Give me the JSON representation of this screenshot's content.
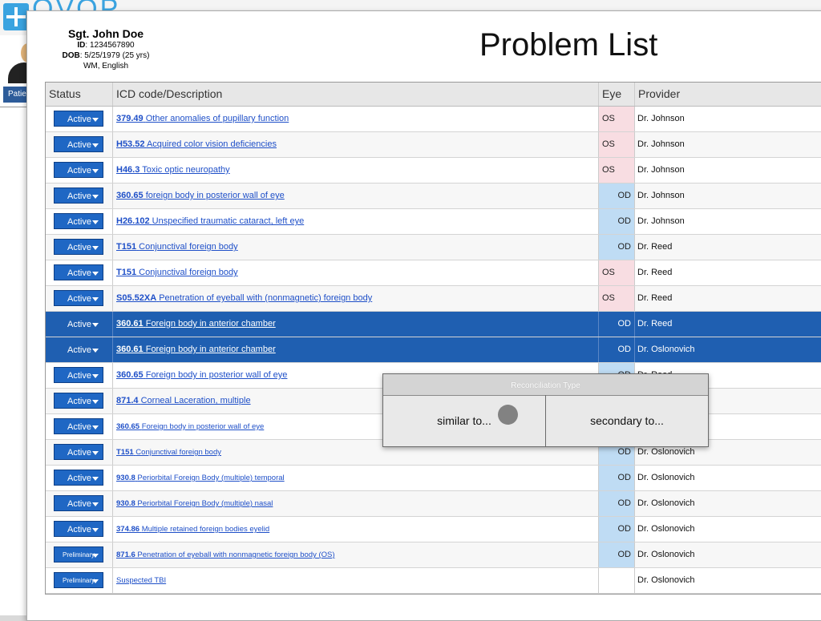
{
  "background": {
    "logo_text": "OVOP",
    "patient_tab": "Patie"
  },
  "patient": {
    "name": "Sgt. John Doe",
    "id_label": "ID",
    "id_value": ": 1234567890",
    "dob_label": "DOB",
    "dob_value": ": 5/25/1979 (25 yrs)",
    "demographics": "WM, English"
  },
  "page_title": "Problem List",
  "table": {
    "headers": {
      "status": "Status",
      "icd": "ICD code/Description",
      "eye": "Eye",
      "provider": "Provider"
    },
    "rows": [
      {
        "status": "Active",
        "code": "379.49",
        "desc": "Other anomalies of pupillary function",
        "eye": "OS",
        "provider": "Dr. Johnson"
      },
      {
        "status": "Active",
        "code": "H53.52",
        "desc": "Acquired color vision deficiencies",
        "eye": "OS",
        "provider": "Dr. Johnson"
      },
      {
        "status": "Active",
        "code": "H46.3",
        "desc": "Toxic optic neuropathy",
        "eye": "OS",
        "provider": "Dr. Johnson"
      },
      {
        "status": "Active",
        "code": "360.65",
        "desc": "foreign body in posterior wall of eye",
        "eye": "OD",
        "provider": "Dr. Johnson"
      },
      {
        "status": "Active",
        "code": "H26.102",
        "desc": "Unspecified traumatic cataract, left eye",
        "eye": "OD",
        "provider": "Dr. Johnson"
      },
      {
        "status": "Active",
        "code": "T151",
        "desc": "Conjunctival foreign body",
        "eye": "OD",
        "provider": "Dr. Reed"
      },
      {
        "status": "Active",
        "code": "T151",
        "desc": "Conjunctival foreign body",
        "eye": "OS",
        "provider": "Dr. Reed"
      },
      {
        "status": "Active",
        "code": "S05.52XA",
        "desc": "Penetration of eyeball with (nonmagnetic) foreign body",
        "eye": "OS",
        "provider": "Dr. Reed"
      },
      {
        "status": "Active",
        "code": "360.61",
        "desc": "Foreign body in anterior chamber",
        "eye": "OD",
        "provider": "Dr. Reed",
        "selected": true
      },
      {
        "status": "Active",
        "code": "360.61",
        "desc": "Foreign body in anterior chamber",
        "eye": "OD",
        "provider": "Dr. Oslonovich",
        "selected": true
      },
      {
        "status": "Active",
        "code": "360.65",
        "desc": "Foreign body in posterior wall of eye",
        "eye": "OD",
        "provider": "Dr. Reed"
      },
      {
        "status": "Active",
        "code": "871.4",
        "desc": "Corneal Laceration, multiple",
        "eye": "",
        "provider": ""
      },
      {
        "status": "Active",
        "code": "360.65",
        "desc": "Foreign body in posterior wall of eye",
        "eye": "",
        "provider": "",
        "small": true
      },
      {
        "status": "Active",
        "code": "T151",
        "desc": "Conjunctival foreign body",
        "eye": "OD",
        "provider": "Dr. Oslonovich",
        "small": true
      },
      {
        "status": "Active",
        "code": "930.8",
        "desc": "Periorbital Foreign Body (multiple) temporal",
        "eye": "OD",
        "provider": "Dr. Oslonovich",
        "small": true
      },
      {
        "status": "Active",
        "code": "930.8",
        "desc": "Periorbital Foreign Body (multiple) nasal",
        "eye": "OD",
        "provider": "Dr. Oslonovich",
        "small": true
      },
      {
        "status": "Active",
        "code": "374.86",
        "desc": "Multiple retained foreign bodies eyelid",
        "eye": "OD",
        "provider": "Dr. Oslonovich",
        "small": true
      },
      {
        "status": "Preliminary",
        "code": "871.6",
        "desc": "Penetration of eyeball with nonmagnetic foreign body (OS)",
        "eye": "OD",
        "provider": "Dr. Oslonovich",
        "small": true
      },
      {
        "status": "Preliminary",
        "code": "",
        "desc": "Suspected TBI",
        "eye": "",
        "provider": "Dr. Oslonovich",
        "small": true
      }
    ]
  },
  "popup": {
    "title": "Reconciliation Type",
    "option_similar": "similar to...",
    "option_secondary": "secondary to..."
  },
  "colors": {
    "status_button": "#1f67c4",
    "selected_row": "#1f5fb1",
    "eye_os": "#f8dde2",
    "eye_od": "#bfdcf4",
    "link": "#1e4fc8"
  }
}
